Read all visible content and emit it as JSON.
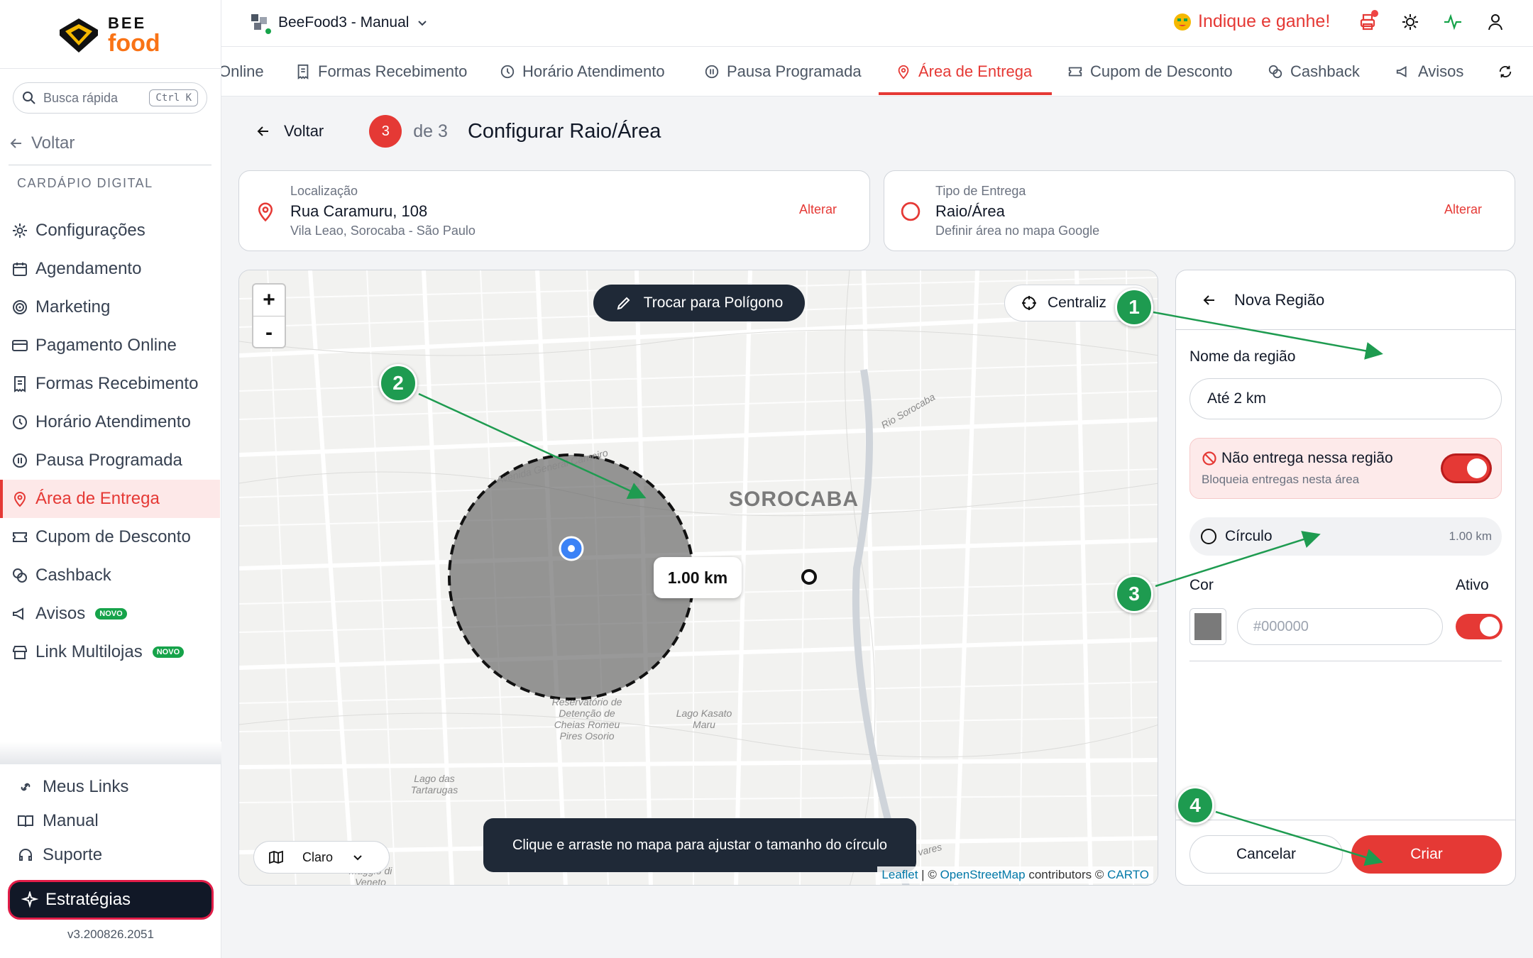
{
  "sidebar": {
    "logo": {
      "line1": "BEE",
      "line2": "food"
    },
    "search": {
      "placeholder": "Busca rápida",
      "shortcut": "Ctrl K"
    },
    "back": "Voltar",
    "section": "CARDÁPIO DIGITAL",
    "items": [
      {
        "label": "Configurações",
        "icon": "gear-icon"
      },
      {
        "label": "Agendamento",
        "icon": "calendar-icon"
      },
      {
        "label": "Marketing",
        "icon": "target-icon"
      },
      {
        "label": "Pagamento Online",
        "icon": "card-icon"
      },
      {
        "label": "Formas Recebimento",
        "icon": "receipt-icon"
      },
      {
        "label": "Horário Atendimento",
        "icon": "clock-icon"
      },
      {
        "label": "Pausa Programada",
        "icon": "pause-icon"
      },
      {
        "label": "Área de Entrega",
        "icon": "pin-icon",
        "active": true
      },
      {
        "label": "Cupom de Desconto",
        "icon": "ticket-icon"
      },
      {
        "label": "Cashback",
        "icon": "coins-icon"
      },
      {
        "label": "Avisos",
        "icon": "megaphone-icon",
        "badge": "NOVO"
      },
      {
        "label": "Link Multilojas",
        "icon": "store-icon",
        "badge": "NOVO"
      }
    ],
    "bottom": [
      {
        "label": "Meus Links",
        "icon": "link-icon"
      },
      {
        "label": "Manual",
        "icon": "book-icon"
      },
      {
        "label": "Suporte",
        "icon": "headset-icon"
      }
    ],
    "strategies": "Estratégias",
    "version": "v3.200826.2051"
  },
  "header": {
    "store": "BeeFood3 - Manual",
    "indique": "Indique e ganhe!",
    "icons": [
      "printer-icon",
      "sun-icon",
      "activity-icon",
      "user-icon"
    ]
  },
  "tabs": [
    {
      "label": "Online",
      "icon": "none"
    },
    {
      "label": "Formas Recebimento",
      "icon": "receipt-icon"
    },
    {
      "label": "Horário Atendimento",
      "icon": "clock-icon"
    },
    {
      "label": "Pausa Programada",
      "icon": "pause-icon"
    },
    {
      "label": "Área de Entrega",
      "icon": "pin-icon",
      "active": true
    },
    {
      "label": "Cupom de Desconto",
      "icon": "ticket-icon"
    },
    {
      "label": "Cashback",
      "icon": "coins-icon"
    },
    {
      "label": "Avisos",
      "icon": "megaphone-icon"
    }
  ],
  "step": {
    "back": "Voltar",
    "current": "3",
    "of": "de 3",
    "title": "Configurar Raio/Área"
  },
  "location_card": {
    "label": "Localização",
    "value": "Rua Caramuru, 108",
    "sub": "Vila Leao, Sorocaba - São Paulo",
    "action": "Alterar"
  },
  "delivery_card": {
    "label": "Tipo de Entrega",
    "value": "Raio/Área",
    "sub": "Definir área no mapa Google",
    "action": "Alterar"
  },
  "map": {
    "zoom_in": "+",
    "zoom_out": "-",
    "polygon_button": "Trocar para Polígono",
    "center_button": "Centraliz",
    "radius_label": "1.00 km",
    "city": "SOROCABA",
    "places": {
      "reservatorio": "Reservatório de Detenção de Cheias Romeu Pires Osorio",
      "lago": "Lago Kasato Maru",
      "tartarugas": "Lago das Tartarugas",
      "avenida": "Avenida General Carneiro",
      "maggio": "maggio di Veneto",
      "vares": "vares",
      "rio_sorocaba": "Rio Sorocaba"
    },
    "tooltip": "Clique e arraste no mapa para ajustar o tamanho do círculo",
    "style_select": "Claro",
    "attribution": {
      "leaflet": "Leaflet",
      "sep": " | © ",
      "osm": "OpenStreetMap",
      "contrib": " contributors © ",
      "carto": "CARTO"
    }
  },
  "panel": {
    "title": "Nova Região",
    "name_label": "Nome da região",
    "name_value": "Até 2 km",
    "block_title": "Não entrega nessa região",
    "block_sub": "Bloqueia entregas nesta área",
    "block_enabled": true,
    "shape_label": "Círculo",
    "shape_km": "1.00 km",
    "color_label": "Cor",
    "active_label": "Ativo",
    "active_enabled": true,
    "color_placeholder": "#000000",
    "color_value": "#7a7a7a",
    "cancel": "Cancelar",
    "create": "Criar"
  },
  "annotations": [
    "1",
    "2",
    "3",
    "4"
  ],
  "colors": {
    "accent": "#e53935",
    "annotation": "#1e9b50",
    "dark": "#1f2937"
  }
}
